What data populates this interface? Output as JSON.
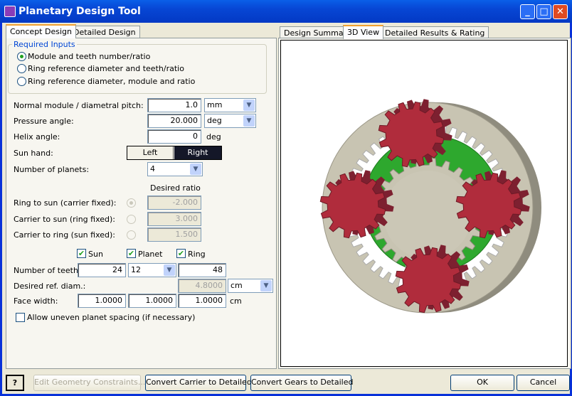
{
  "window": {
    "title": "Planetary Design Tool",
    "minimize": "_",
    "maximize": "□",
    "close": "✕"
  },
  "left_tabs": [
    "Concept Design",
    "Detailed Design"
  ],
  "right_tabs": [
    "Design Summary",
    "3D View",
    "Detailed Results & Rating"
  ],
  "required_inputs": {
    "legend": "Required Inputs",
    "options": [
      "Module and teeth number/ratio",
      "Ring reference diameter and teeth/ratio",
      "Ring reference diameter, module and ratio"
    ],
    "selected": 0
  },
  "module": {
    "label": "Normal module / diametral pitch:",
    "value": "1.0",
    "unit": "mm"
  },
  "pressure": {
    "label": "Pressure angle:",
    "value": "20.000",
    "unit": "deg"
  },
  "helix": {
    "label": "Helix angle:",
    "value": "0",
    "unit": "deg"
  },
  "sun_hand": {
    "label": "Sun hand:",
    "left": "Left",
    "right": "Right",
    "selected": "Right"
  },
  "planets": {
    "label": "Number of planets:",
    "value": "4"
  },
  "ratios": {
    "header": "Desired ratio",
    "rows": [
      {
        "label": "Ring to sun (carrier fixed):",
        "value": "-2.000",
        "selected": true
      },
      {
        "label": "Carrier to sun (ring fixed):",
        "value": "3.000",
        "selected": false
      },
      {
        "label": "Carrier to ring (sun fixed):",
        "value": "1.500",
        "selected": false
      }
    ]
  },
  "gears": {
    "sun": "Sun",
    "planet": "Planet",
    "ring": "Ring",
    "check": "✔"
  },
  "teeth": {
    "label": "Number of teeth:",
    "sun": "24",
    "planet": "12",
    "ring": "48"
  },
  "ref_diam": {
    "label": "Desired ref. diam.:",
    "value": "4.8000",
    "unit": "cm"
  },
  "face_width": {
    "label": "Face width:",
    "sun": "1.0000",
    "planet": "1.0000",
    "ring": "1.0000",
    "unit": "cm"
  },
  "uneven": {
    "label": "Allow uneven planet spacing (if necessary)",
    "checked": false
  },
  "buttons": {
    "help": "?",
    "edit": "Edit Geometry Constraints...",
    "carrier": "Convert Carrier to Detailed",
    "gears": "Convert Gears to Detailed",
    "ok": "OK",
    "cancel": "Cancel"
  },
  "colors": {
    "ring": "#c8c4b2",
    "sun": "#c8c4b2",
    "planet": "#b02c3c",
    "carrier": "#2ea82e"
  }
}
